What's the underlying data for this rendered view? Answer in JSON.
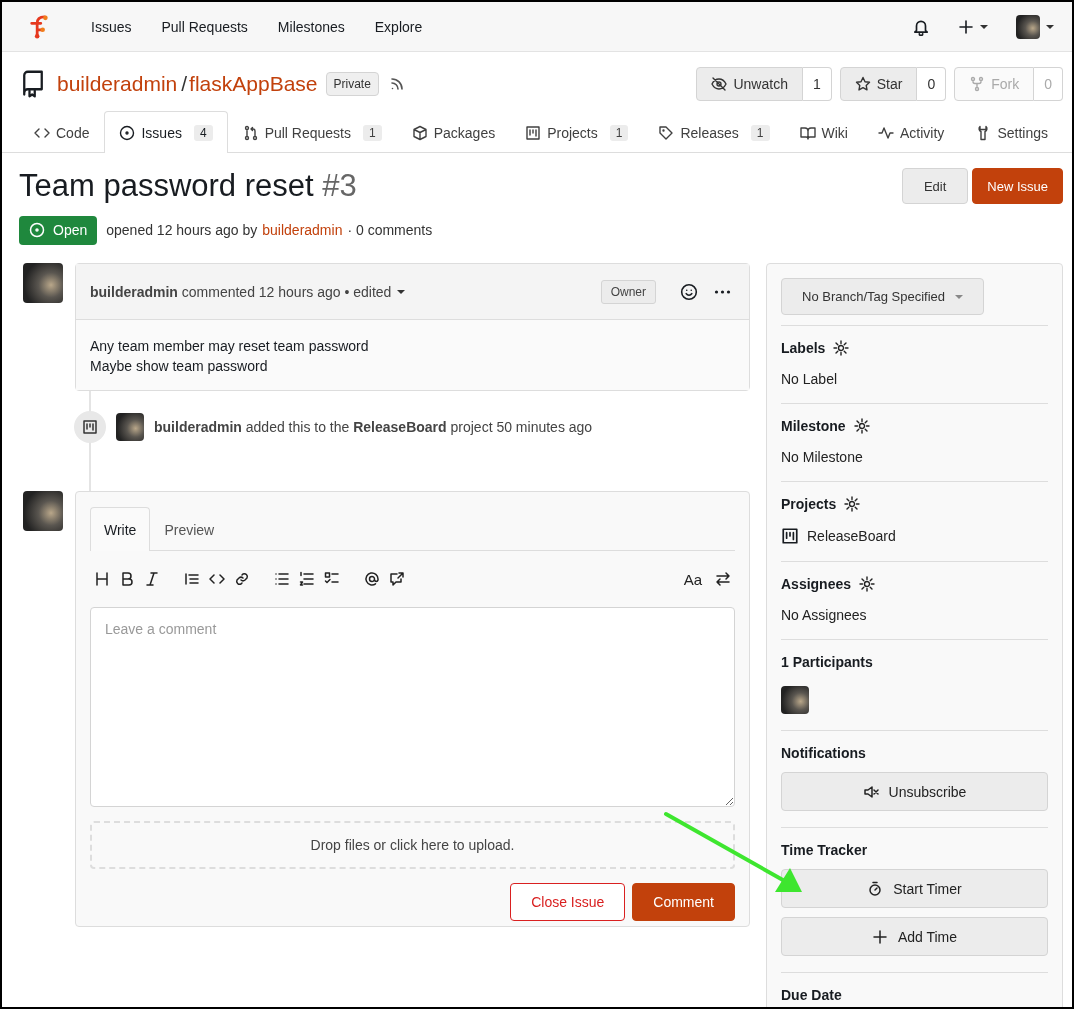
{
  "nav": {
    "items": [
      "Issues",
      "Pull Requests",
      "Milestones",
      "Explore"
    ]
  },
  "repo": {
    "owner": "builderadmin",
    "separator": "/",
    "name": "flaskAppBase",
    "visibility": "Private",
    "actions": [
      {
        "label": "Unwatch",
        "count": "1",
        "disabled": false
      },
      {
        "label": "Star",
        "count": "0",
        "disabled": false
      },
      {
        "label": "Fork",
        "count": "0",
        "disabled": true
      }
    ]
  },
  "tabs": [
    {
      "label": "Code",
      "selected": false
    },
    {
      "label": "Issues",
      "count": "4",
      "selected": true
    },
    {
      "label": "Pull Requests",
      "count": "1",
      "selected": false
    },
    {
      "label": "Packages",
      "selected": false
    },
    {
      "label": "Projects",
      "count": "1",
      "selected": false
    },
    {
      "label": "Releases",
      "count": "1",
      "selected": false
    },
    {
      "label": "Wiki",
      "selected": false
    },
    {
      "label": "Activity",
      "selected": false
    }
  ],
  "settings_tab": {
    "label": "Settings"
  },
  "issue": {
    "title": "Team password reset",
    "number": "#3",
    "actions": [
      {
        "label": "Edit",
        "kind": "basic"
      },
      {
        "label": "New Issue",
        "kind": "primary"
      }
    ],
    "state": "Open",
    "meta": "opened 12 hours ago by",
    "author": "builderadmin",
    "comments": "· 0 comments"
  },
  "comment": {
    "header": "**builderadmin** commented 12 hours ago • edited",
    "role": "Owner",
    "body": [
      "Any team member may reset team password",
      "Maybe show team password"
    ]
  },
  "event": {
    "text": "**builderadmin** added this to the **ReleaseBoard** project 50 minutes ago"
  },
  "editor": {
    "tabs": [
      {
        "label": "Write",
        "selected": true
      },
      {
        "label": "Preview",
        "selected": false
      }
    ],
    "style_toggle": "Aa",
    "placeholder": "Leave a comment",
    "dropzone": "Drop files or click here to upload.",
    "buttons": [
      {
        "label": "Close Issue",
        "kind": "danger"
      },
      {
        "label": "Comment",
        "kind": "primary"
      }
    ]
  },
  "sidebar": {
    "branch": "No Branch/Tag Specified",
    "sections": [
      {
        "kind": "value",
        "title": "Labels",
        "editable": true,
        "value": "No Label"
      },
      {
        "kind": "value",
        "title": "Milestone",
        "editable": true,
        "value": "No Milestone"
      },
      {
        "kind": "project",
        "title": "Projects",
        "editable": true,
        "value": "ReleaseBoard"
      },
      {
        "kind": "value",
        "title": "Assignees",
        "editable": true,
        "value": "No Assignees"
      },
      {
        "kind": "avatars",
        "title": "1 Participants",
        "editable": false
      },
      {
        "kind": "buttons",
        "title": "Notifications",
        "editable": false,
        "buttons": [
          {
            "label": "Unsubscribe",
            "kind": "mute"
          }
        ]
      },
      {
        "kind": "buttons",
        "title": "Time Tracker",
        "editable": false,
        "buttons": [
          {
            "label": "Start Timer",
            "kind": "timer"
          },
          {
            "label": "Add Time",
            "kind": "add"
          }
        ]
      },
      {
        "kind": "heading",
        "title": "Due Date",
        "editable": false
      }
    ]
  }
}
